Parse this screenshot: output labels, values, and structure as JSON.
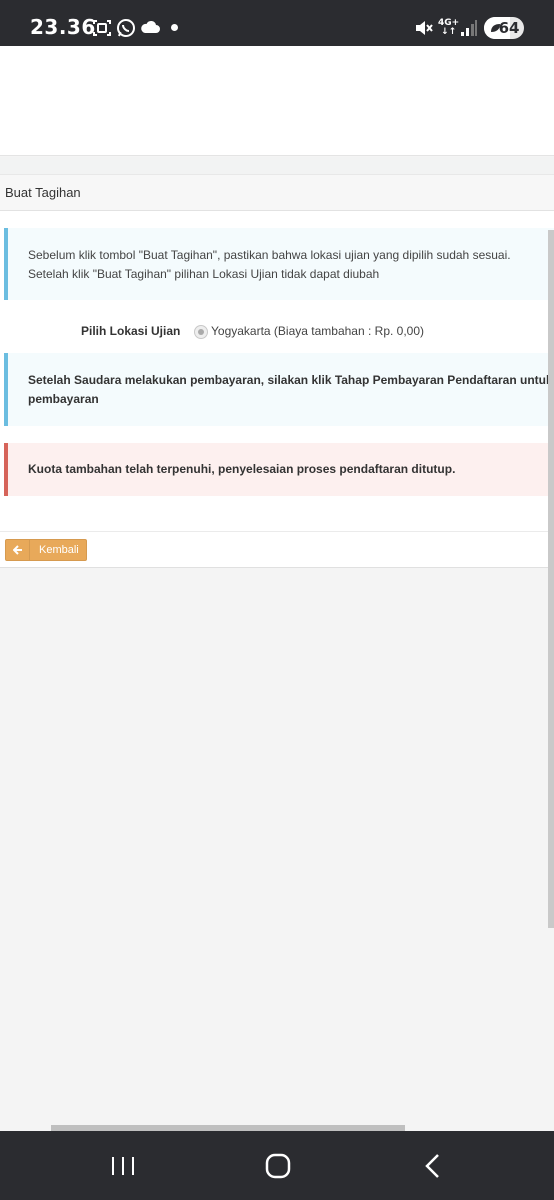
{
  "status_bar": {
    "time": "23.36",
    "network_label": "4G+",
    "battery_level": "64",
    "icons": [
      "screenshot-icon",
      "whatsapp-icon",
      "cloud-icon",
      "dot-icon",
      "mute-icon",
      "signal-icon",
      "battery-icon"
    ]
  },
  "panel": {
    "title": "Buat Tagihan",
    "info_notice": {
      "line1": "Sebelum klik tombol \"Buat Tagihan\", pastikan bahwa lokasi ujian yang dipilih sudah sesuai.",
      "line2": "Setelah klik \"Buat Tagihan\" pilihan Lokasi Ujian tidak dapat diubah"
    },
    "location_field": {
      "label": "Pilih Lokasi Ujian",
      "option": "Yogyakarta (Biaya tambahan : Rp. 0,00)"
    },
    "payment_notice": {
      "line1": "Setelah Saudara melakukan pembayaran, silakan klik Tahap Pembayaran Pendaftaran untuk",
      "line2": "pembayaran"
    },
    "quota_alert": "Kuota tambahan telah terpenuhi, penyelesaian proses pendaftaran ditutup.",
    "back_button": "Kembali"
  },
  "colors": {
    "info_border": "#6bbde0",
    "danger_border": "#d6645a",
    "button_warning": "#e8a95a",
    "system_bar": "#2b2c30"
  },
  "nav_bar": {
    "icons": [
      "recent-apps-icon",
      "home-icon",
      "back-icon"
    ]
  }
}
